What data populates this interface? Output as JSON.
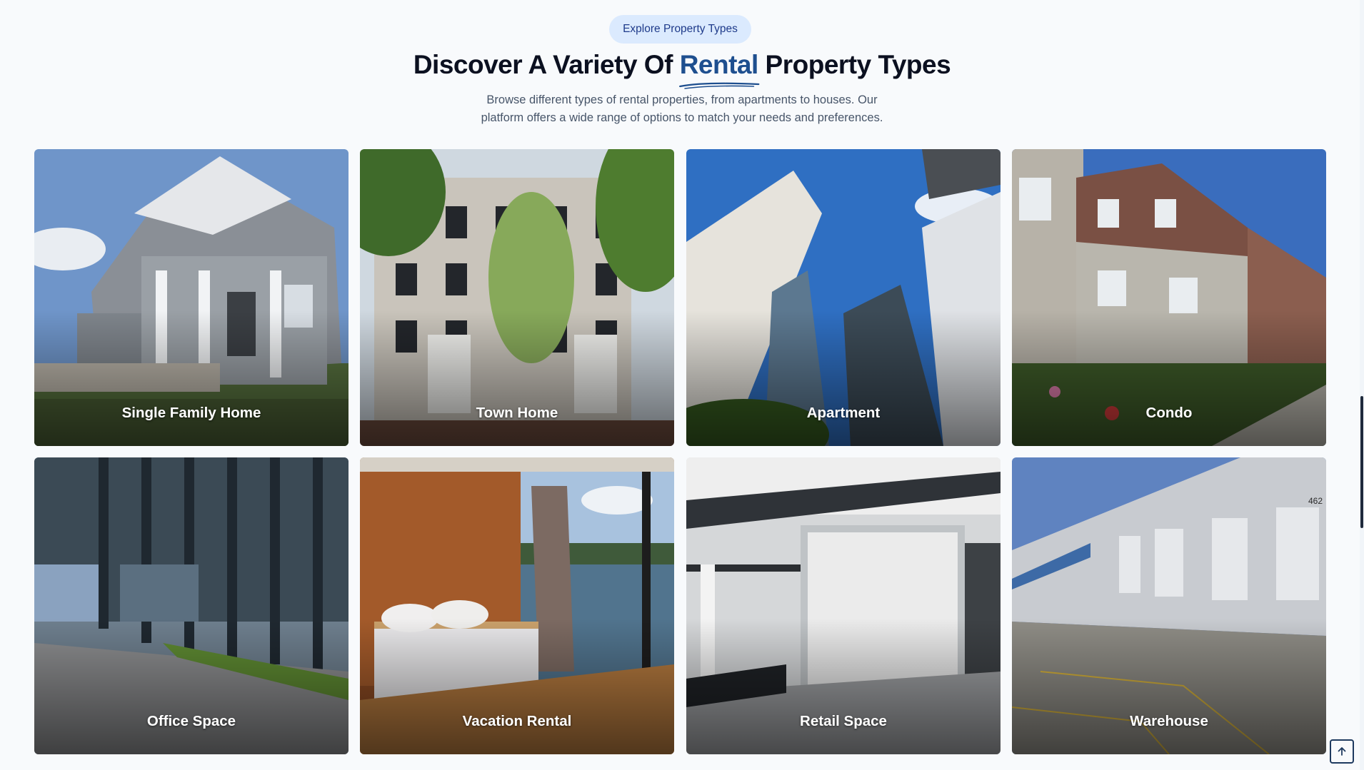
{
  "header": {
    "pill_label": "Explore Property Types",
    "title_before": "Discover A Variety Of ",
    "title_accent": "Rental",
    "title_after": " Property Types",
    "subtitle_line1": "Browse different types of rental properties, from apartments to houses. Our",
    "subtitle_line2": "platform offers a wide range of options to match your needs and preferences."
  },
  "cards": [
    {
      "label": "Single Family Home"
    },
    {
      "label": "Town Home"
    },
    {
      "label": "Apartment"
    },
    {
      "label": "Condo"
    },
    {
      "label": "Office Space"
    },
    {
      "label": "Vacation Rental"
    },
    {
      "label": "Retail Space"
    },
    {
      "label": "Warehouse"
    }
  ],
  "colors": {
    "background": "#f8fafc",
    "accent": "#1e4f8f",
    "pill_bg": "#dbeafe"
  },
  "icons": {
    "scroll_top": "arrow-up-icon"
  }
}
